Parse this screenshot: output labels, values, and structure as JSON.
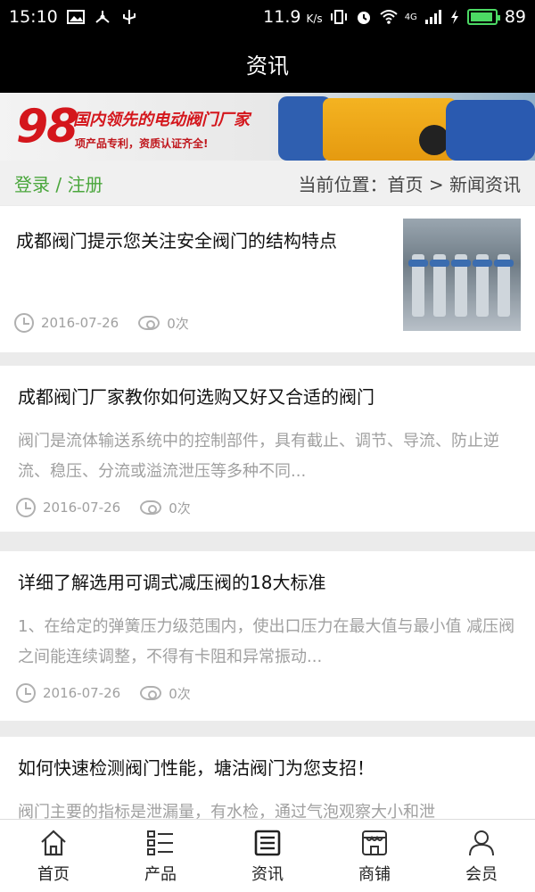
{
  "status_bar": {
    "time": "15:10",
    "speed": "11.9",
    "speed_unit": "K/s",
    "network": "4G",
    "battery": "89"
  },
  "header": {
    "title": "资讯"
  },
  "banner": {
    "number": "98",
    "headline": "国内领先的电动阀门厂家",
    "subline": "项产品专利，资质认证齐全!"
  },
  "breadcrumb_bar": {
    "login_label": "登录 / 注册",
    "location": "当前位置：首页 > 新闻资讯"
  },
  "articles": [
    {
      "title": "成都阀门提示您关注安全阀门的结构特点",
      "summary": "",
      "date": "2016-07-26",
      "views": "0次"
    },
    {
      "title": "成都阀门厂家教你如何选购又好又合适的阀门",
      "summary": "阀门是流体输送系统中的控制部件，具有截止、调节、导流、防止逆流、稳压、分流或溢流泄压等多种不同...",
      "date": "2016-07-26",
      "views": "0次"
    },
    {
      "title": "详细了解选用可调式减压阀的18大标准",
      "summary": "1、在给定的弹簧压力级范围内，使出口压力在最大值与最小值 减压阀之间能连续调整，不得有卡阻和异常振动...",
      "date": "2016-07-26",
      "views": "0次"
    },
    {
      "title": "如何快速检测阀门性能，塘沽阀门为您支招！",
      "summary": "阀门主要的指标是泄漏量，有水检，通过气泡观察大小和泄",
      "date": "",
      "views": ""
    }
  ],
  "tabs": [
    {
      "label": "首页",
      "icon": "home-icon"
    },
    {
      "label": "产品",
      "icon": "list-icon"
    },
    {
      "label": "资讯",
      "icon": "news-icon"
    },
    {
      "label": "商铺",
      "icon": "store-icon"
    },
    {
      "label": "会员",
      "icon": "user-icon"
    }
  ]
}
